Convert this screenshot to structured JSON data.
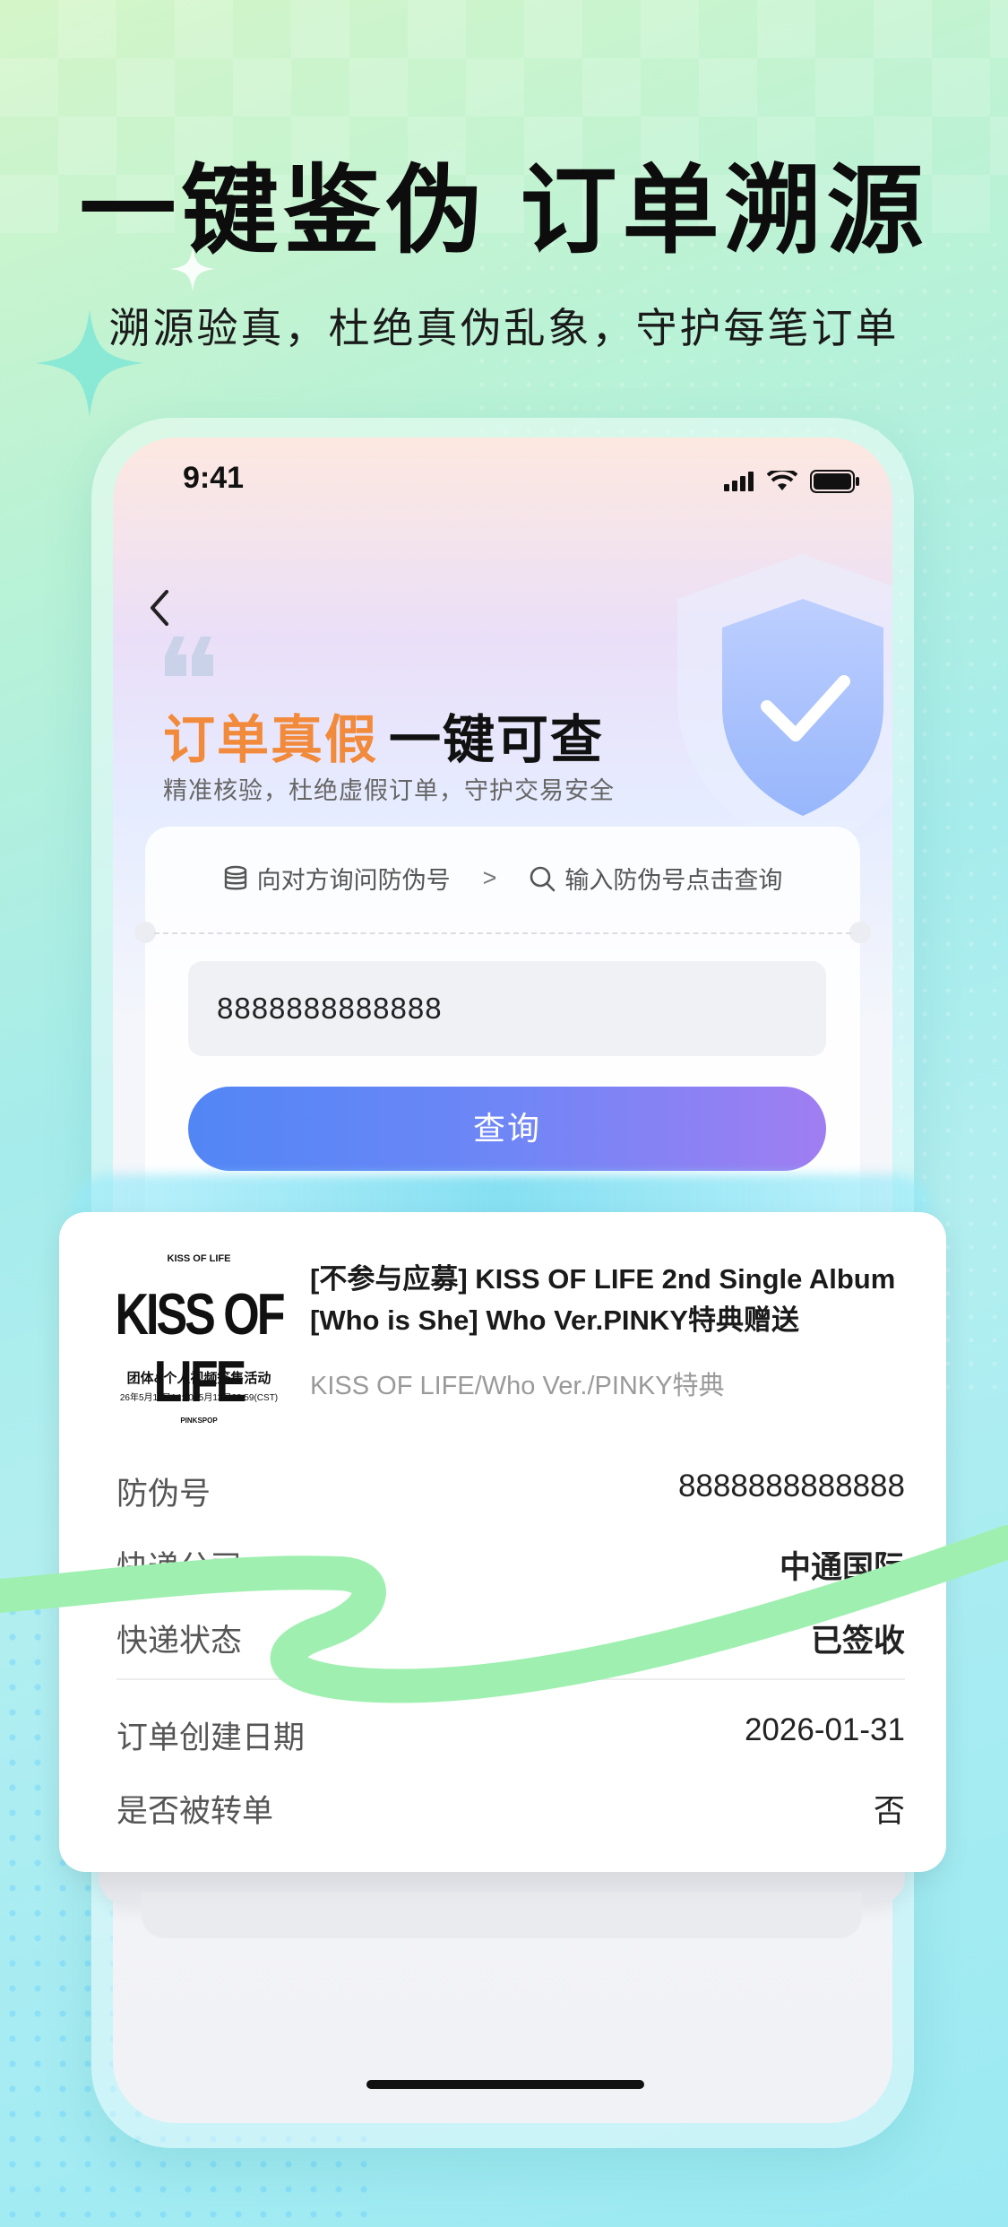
{
  "banner": {
    "headline": "一键鉴伪 订单溯源",
    "subline": "溯源验真，杜绝真伪乱象，守护每笔订单"
  },
  "status_bar": {
    "time": "9:41"
  },
  "promo": {
    "title_accent": "订单真假",
    "title_rest": "一键可查",
    "subtitle": "精准核验，杜绝虚假订单，守护交易安全"
  },
  "query": {
    "step1": "向对方询问防伪号",
    "arrow": ">",
    "step2": "输入防伪号点击查询",
    "code_value": "8888888888888",
    "button_label": "查询"
  },
  "result": {
    "album_art": {
      "top_text": "KISS OF LIFE",
      "logo_text": "KISS OF LIFE",
      "event_text": "团体&个人视频签售活动",
      "date_text": "26年5月11日14:00~5月13日22:59(CST)",
      "brand_text": "PINKSPOP"
    },
    "title": "[不参与应募] KISS OF LIFE 2nd Single Album [Who is She] Who Ver.PINKY特典赠送",
    "variant": "KISS OF LIFE/Who Ver./PINKY特典",
    "rows": [
      {
        "label": "防伪号",
        "value": "8888888888888"
      },
      {
        "label": "快递公司",
        "value": "中通国际"
      },
      {
        "label": "快递状态",
        "value": "已签收"
      },
      {
        "label": "订单创建日期",
        "value": "2026-01-31"
      },
      {
        "label": "是否被转单",
        "value": "否"
      }
    ]
  },
  "colors": {
    "accent_orange": "#f28a3c",
    "button_gradient_start": "#5286f5",
    "button_gradient_end": "#a07ef2",
    "swoosh_green": "#9ff0b0"
  },
  "icons": [
    "back-chevron-icon",
    "quote-icon",
    "shield-check-icon",
    "database-icon",
    "search-icon",
    "signal-icon",
    "wifi-icon",
    "battery-icon",
    "sparkle-star-icon"
  ]
}
